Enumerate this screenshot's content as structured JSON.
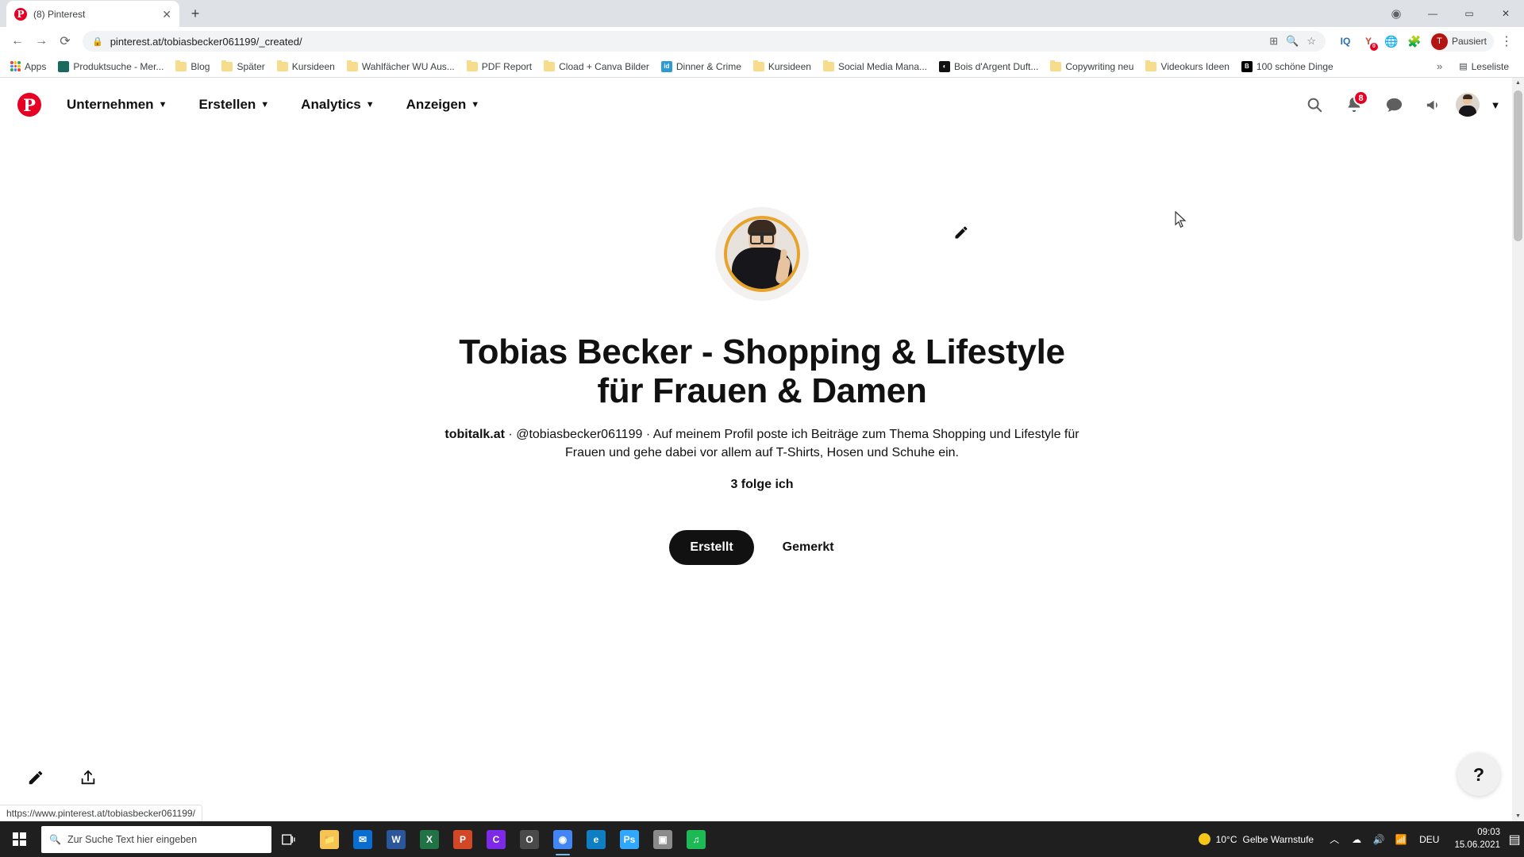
{
  "browser": {
    "tab": {
      "title": "(8) Pinterest",
      "favicon": "pinterest-icon",
      "close_icon": "close-icon"
    },
    "new_tab_icon": "plus-icon",
    "window_controls": {
      "record": "record-icon",
      "minimize": "minimize-icon",
      "maximize": "maximize-icon",
      "close": "close-icon"
    },
    "nav": {
      "back": "back-arrow-icon",
      "forward": "forward-arrow-icon",
      "reload": "reload-icon"
    },
    "omnibox": {
      "lock_icon": "lock-icon",
      "url": "pinterest.at/tobiasbecker061199/_created/",
      "install_icon": "install-app-icon",
      "zoom_icon": "zoom-icon",
      "star_icon": "star-icon"
    },
    "extensions": [
      {
        "name": "iq-extension",
        "label": "IQ"
      },
      {
        "name": "adblock-extension",
        "label": "Y",
        "badge": "0"
      },
      {
        "name": "globe-extension",
        "label": "globe-icon"
      },
      {
        "name": "puzzle-extension",
        "label": "puzzle-icon"
      }
    ],
    "profile": {
      "initial": "T",
      "label": "Pausiert"
    },
    "menu_icon": "three-dot-menu-icon",
    "bookmarks": [
      {
        "label": "Apps",
        "icon": "apps-grid-icon"
      },
      {
        "label": "Produktsuche - Mer...",
        "icon": "site-favicon",
        "color": "#1b6a5e"
      },
      {
        "label": "Blog",
        "icon": "folder-icon"
      },
      {
        "label": "Später",
        "icon": "folder-icon"
      },
      {
        "label": "Kursideen",
        "icon": "folder-icon"
      },
      {
        "label": "Wahlfächer WU Aus...",
        "icon": "folder-icon"
      },
      {
        "label": "PDF Report",
        "icon": "folder-icon"
      },
      {
        "label": "Cload + Canva Bilder",
        "icon": "folder-icon"
      },
      {
        "label": "Dinner & Crime",
        "icon": "site-favicon",
        "color": "#2e9bd6",
        "glyph": "id"
      },
      {
        "label": "Kursideen",
        "icon": "folder-icon"
      },
      {
        "label": "Social Media Mana...",
        "icon": "folder-icon"
      },
      {
        "label": "Bois d'Argent Duft...",
        "icon": "site-favicon",
        "color": "#111111",
        "glyph": "◐"
      },
      {
        "label": "Copywriting neu",
        "icon": "folder-icon"
      },
      {
        "label": "Videokurs Ideen",
        "icon": "folder-icon"
      },
      {
        "label": "100 schöne Dinge",
        "icon": "site-favicon",
        "color": "#000000",
        "glyph": "B"
      }
    ],
    "bookmarks_overflow": "»",
    "reading_list": {
      "label": "Leseliste",
      "icon": "reading-list-icon"
    },
    "status_url": "https://www.pinterest.at/tobiasbecker061199/"
  },
  "pinterest": {
    "logo": "pinterest-logo",
    "nav": [
      {
        "label": "Unternehmen",
        "chevron": "chevron-down-icon"
      },
      {
        "label": "Erstellen",
        "chevron": "chevron-down-icon"
      },
      {
        "label": "Analytics",
        "chevron": "chevron-down-icon"
      },
      {
        "label": "Anzeigen",
        "chevron": "chevron-down-icon"
      }
    ],
    "actions": {
      "search_icon": "search-icon",
      "notifications_icon": "bell-icon",
      "notifications_count": "8",
      "messages_icon": "chat-bubble-icon",
      "alerts_icon": "megaphone-icon",
      "avatar": "user-avatar",
      "account_chevron": "chevron-down-icon"
    },
    "profile": {
      "edit_icon": "pencil-edit-icon",
      "name": "Tobias Becker - Shopping & Lifestyle für Frauen & Damen",
      "website": "tobitalk.at",
      "separator_1": "·",
      "username": "@tobiasbecker061199",
      "separator_2": "·",
      "bio": "Auf meinem Profil poste ich Beiträge zum Thema Shopping und Lifestyle für Frauen und gehe dabei vor allem auf T-Shirts, Hosen und Schuhe ein.",
      "following": "3 folge ich",
      "tabs": [
        {
          "label": "Erstellt",
          "active": true
        },
        {
          "label": "Gemerkt",
          "active": false
        }
      ],
      "left_actions": [
        {
          "name": "edit-profile-icon",
          "glyph": "✎"
        },
        {
          "name": "share-profile-icon",
          "glyph": "⬆"
        }
      ],
      "help_button": "?"
    }
  },
  "taskbar": {
    "start": "windows-start-icon",
    "search_placeholder": "Zur Suche Text hier eingeben",
    "search_icon": "search-icon",
    "task_view": "task-view-icon",
    "apps": [
      {
        "name": "file-explorer",
        "glyph": "📁",
        "color": "#f6c453",
        "open": false
      },
      {
        "name": "mail",
        "glyph": "✉",
        "color": "#0a6ed1",
        "open": false
      },
      {
        "name": "word",
        "glyph": "W",
        "color": "#2b579a",
        "open": false
      },
      {
        "name": "excel",
        "glyph": "X",
        "color": "#217346",
        "open": false
      },
      {
        "name": "powerpoint",
        "glyph": "P",
        "color": "#d24726",
        "open": false
      },
      {
        "name": "canva",
        "glyph": "C",
        "color": "#7d2ae8",
        "open": false
      },
      {
        "name": "browser-opera",
        "glyph": "O",
        "color": "#4a4a4a",
        "open": false
      },
      {
        "name": "chrome",
        "glyph": "◉",
        "color": "#4285f4",
        "open": true
      },
      {
        "name": "edge",
        "glyph": "e",
        "color": "#0f7fc3",
        "open": false
      },
      {
        "name": "photoshop",
        "glyph": "Ps",
        "color": "#31a8ff",
        "open": false
      },
      {
        "name": "photos",
        "glyph": "▣",
        "color": "#8b8b8b",
        "open": false
      },
      {
        "name": "spotify",
        "glyph": "♫",
        "color": "#1db954",
        "open": false
      }
    ],
    "weather": {
      "temperature": "10°C",
      "description": "Gelbe Warnstufe"
    },
    "tray": {
      "chevron": "show-hidden-icons-icon",
      "cloud": "onedrive-icon",
      "volume": "volume-icon",
      "network": "network-icon",
      "language": "DEU",
      "time": "09:03",
      "date": "15.06.2021",
      "notifications": "action-center-icon"
    }
  }
}
